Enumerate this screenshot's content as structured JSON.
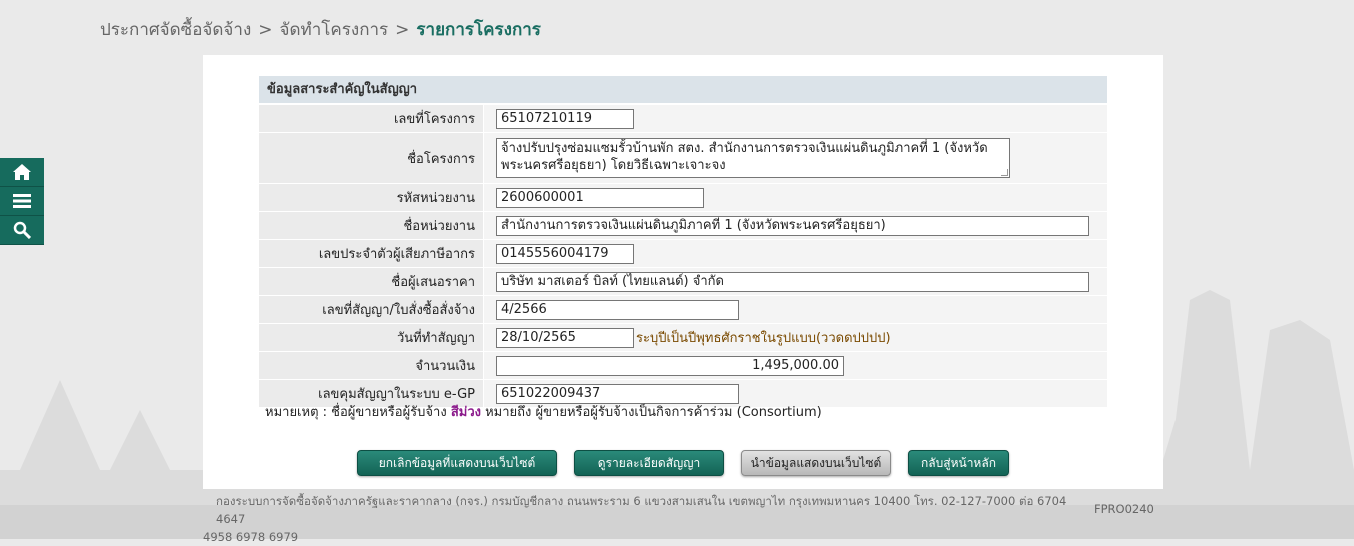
{
  "breadcrumb": {
    "items": [
      "ประกาศจัดซื้อจัดจ้าง",
      "จัดทำโครงการ"
    ],
    "separator": ">",
    "current": "รายการโครงการ"
  },
  "side_nav": [
    {
      "icon": "home-icon"
    },
    {
      "icon": "menu-icon"
    },
    {
      "icon": "search-icon"
    }
  ],
  "section": {
    "title": "ข้อมูลสาระสำคัญในสัญญา"
  },
  "fields": {
    "project_no": {
      "label": "เลขที่โครงการ",
      "value": "65107210119"
    },
    "project_name": {
      "label": "ชื่อโครงการ",
      "value": "จ้างปรับปรุงซ่อมแซมรั้วบ้านพัก สตง.  สำนักงานการตรวจเงินแผ่นดินภูมิภาคที่ 1 (จังหวัดพระนครศรีอยุธยา) โดยวิธีเฉพาะเจาะจง"
    },
    "agency_code": {
      "label": "รหัสหน่วยงาน",
      "value": "2600600001"
    },
    "agency_name": {
      "label": "ชื่อหน่วยงาน",
      "value": "สำนักงานการตรวจเงินแผ่นดินภูมิภาคที่ 1 (จังหวัดพระนครศรีอยุธยา)"
    },
    "tax_id": {
      "label": "เลขประจำตัวผู้เสียภาษีอากร",
      "value": "0145556004179"
    },
    "bidder_name": {
      "label": "ชื่อผู้เสนอราคา",
      "value": "บริษัท มาสเตอร์ บิลท์ (ไทยแลนด์) จำกัด"
    },
    "contract_no": {
      "label": "เลขที่สัญญา/ใบสั่งซื้อสั่งจ้าง",
      "value": "4/2566"
    },
    "contract_date": {
      "label": "วันที่ทำสัญญา",
      "value": "28/10/2565",
      "hint": "ระบุปีเป็นปีพุทธศักราชในรูปแบบ(ววดดปปปป)"
    },
    "amount": {
      "label": "จำนวนเงิน",
      "value": "1,495,000.00"
    },
    "egp_contract_no": {
      "label": "เลขคุมสัญญาในระบบ e-GP",
      "value": "651022009437"
    }
  },
  "note": {
    "prefix": "หมายเหตุ : ชื่อผู้ขายหรือผู้รับจ้าง ",
    "highlight": "สีม่วง",
    "suffix": " หมายถึง ผู้ขายหรือผู้รับจ้างเป็นกิจการค้าร่วม (Consortium)",
    "highlight_color": "#8b1a8b"
  },
  "buttons": {
    "cancel_display": "ยกเลิกข้อมูลที่แสดงบนเว็บไซต์",
    "view_contract": "ดูรายละเอียดสัญญา",
    "publish": "นำข้อมูลแสดงบนเว็บไซต์",
    "back_home": "กลับสู่หน้าหลัก"
  },
  "footer": {
    "line1": "กองระบบการจัดซื้อจัดจ้างภาครัฐและราคากลาง (กจร.) กรมบัญชีกลาง ถนนพระราม 6 แขวงสามเสนใน เขตพญาไท กรุงเทพมหานคร 10400 โทร. 02-127-7000 ต่อ 6704 4647",
    "line2": "4958 6978 6979",
    "form_code": "FPRO0240"
  },
  "colors": {
    "accent": "#166b5d",
    "section_header_bg": "#dbe3e9",
    "breadcrumb_current": "#1a6e62"
  }
}
